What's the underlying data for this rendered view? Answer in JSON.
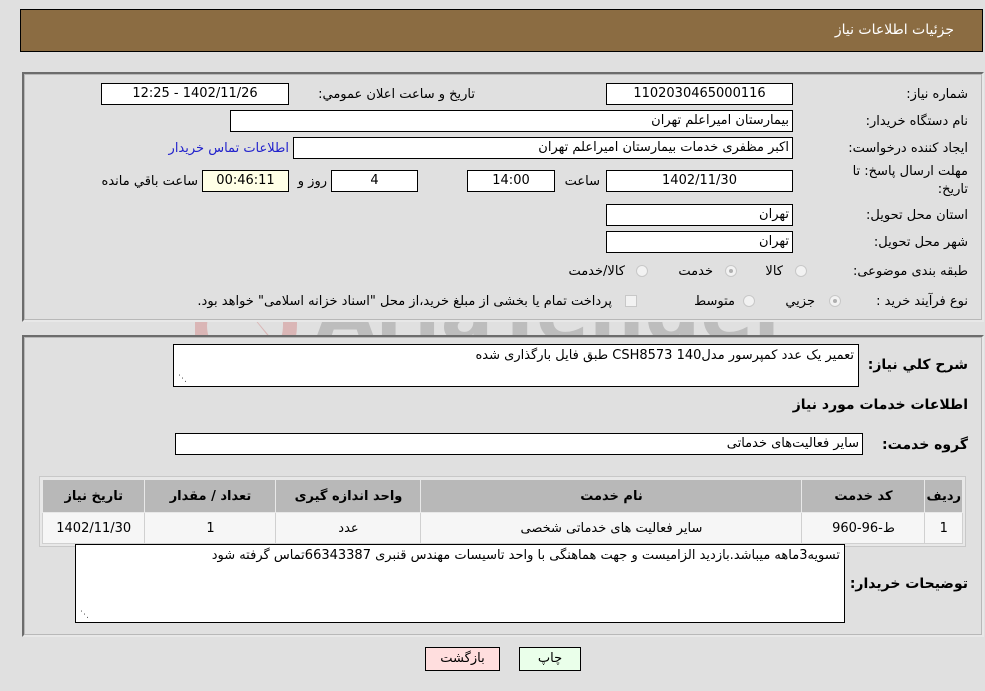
{
  "header": {
    "title": "جزئیات اطلاعات نیاز"
  },
  "details": {
    "need_number": {
      "label": "شماره نیاز:",
      "value": "1102030465000116"
    },
    "announce_datetime": {
      "label": "تاریخ و ساعت اعلان عمومي:",
      "value": "1402/11/26 - 12:25"
    },
    "buyer_org": {
      "label": "نام دستگاه خریدار:",
      "value": "بیمارستان امیراعلم تهران"
    },
    "requester": {
      "label": "ایجاد کننده درخواست:",
      "value": "اکبر مظفری خدمات بیمارستان امیراعلم تهران"
    },
    "buyer_contact_link": "اطلاعات تماس خریدار",
    "deadline": {
      "label_line1": "مهلت ارسال پاسخ: تا",
      "label_line2": "تاریخ:",
      "date": "1402/11/30",
      "time_label": "ساعت",
      "time": "14:00",
      "days": "4",
      "days_label": "روز و",
      "remaining": "00:46:11",
      "remaining_label": "ساعت باقي مانده"
    },
    "province": {
      "label": "استان محل تحویل:",
      "value": "تهران"
    },
    "city": {
      "label": "شهر محل تحویل:",
      "value": "تهران"
    },
    "category": {
      "label": "طبقه بندی موضوعی:",
      "options": [
        "کالا",
        "خدمت",
        "کالا/خدمت"
      ],
      "selected": "خدمت"
    },
    "purchase_type": {
      "label": "نوع فرآیند خرید :",
      "options": [
        "جزیي",
        "متوسط"
      ],
      "selected": "جزیي",
      "treasury_note": "پرداخت تمام یا بخشی از مبلغ خرید،از محل \"اسناد خزانه اسلامی\" خواهد بود."
    }
  },
  "description": {
    "label": "شرح کلي نیاز:",
    "value": "تعمیر یک عدد کمپرسور مدل140  CSH8573  طبق فایل بارگذاری شده"
  },
  "services_section_title": "اطلاعات خدمات مورد نیاز",
  "service_group": {
    "label": "گروه خدمت:",
    "value": "سایر فعالیت‌های خدماتی"
  },
  "table": {
    "headers": [
      "ردیف",
      "کد خدمت",
      "نام خدمت",
      "واحد اندازه گیری",
      "تعداد / مقدار",
      "تاریخ نیاز"
    ],
    "rows": [
      [
        "1",
        "ط-96-960",
        "سایر فعالیت های خدماتی شخصی",
        "عدد",
        "1",
        "1402/11/30"
      ]
    ]
  },
  "buyer_notes": {
    "label": "توضیحات خریدار:",
    "value": "تسویه3ماهه میباشد.بازدید الزامیست و جهت هماهنگی با واحد تاسیسات مهندس قنبری 66343387تماس گرفته شود"
  },
  "buttons": {
    "print": "چاپ",
    "back": "بازگشت"
  },
  "watermark": {
    "text": "AriaTender.neT"
  },
  "colors": {
    "header_bg": "#8b6c42",
    "print_bg": "#eaffea",
    "back_bg": "#ffdede",
    "link": "#2222cc",
    "remaining_bg": "#ffffe6"
  }
}
